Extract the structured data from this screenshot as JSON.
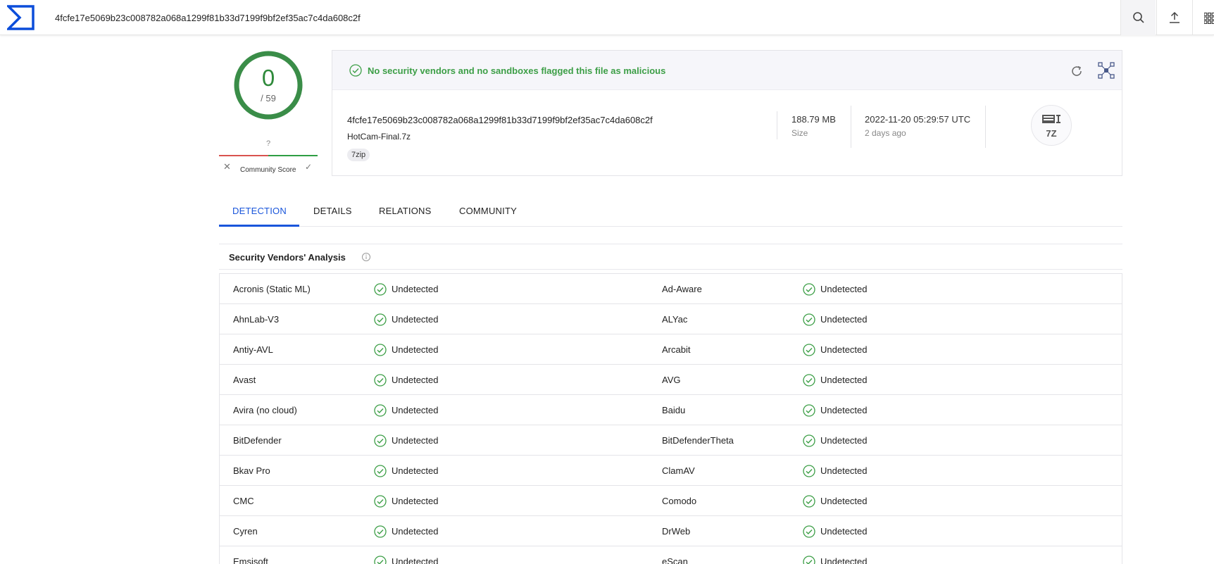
{
  "topbar": {
    "search_value": "4fcfe17e5069b23c008782a068a1299f81b33d7199f9bf2ef35ac7c4da608c2f",
    "icons": [
      "logo-icon",
      "search-icon",
      "upload-icon",
      "apps-grid-icon"
    ]
  },
  "score": {
    "detections": "0",
    "total": "/ 59",
    "ring_color": "#3a8d48"
  },
  "community": {
    "score": "?",
    "label": "Community Score"
  },
  "summary": {
    "message": "No security vendors and no sandboxes flagged this file as malicious",
    "hash": "4fcfe17e5069b23c008782a068a1299f81b33d7199f9bf2ef35ac7c4da608c2f",
    "filename": "HotCam-Final.7z",
    "tag": "7zip",
    "size": "188.79 MB",
    "size_label": "Size",
    "date": "2022-11-20 05:29:57 UTC",
    "date_ago": "2 days ago",
    "file_type": "7Z"
  },
  "tabs": [
    {
      "label": "DETECTION",
      "active": true
    },
    {
      "label": "DETAILS",
      "active": false
    },
    {
      "label": "RELATIONS",
      "active": false
    },
    {
      "label": "COMMUNITY",
      "active": false
    }
  ],
  "section": {
    "title": "Security Vendors' Analysis"
  },
  "vendors": [
    {
      "left": {
        "name": "Acronis (Static ML)",
        "result": "Undetected"
      },
      "right": {
        "name": "Ad-Aware",
        "result": "Undetected"
      }
    },
    {
      "left": {
        "name": "AhnLab-V3",
        "result": "Undetected"
      },
      "right": {
        "name": "ALYac",
        "result": "Undetected"
      }
    },
    {
      "left": {
        "name": "Antiy-AVL",
        "result": "Undetected"
      },
      "right": {
        "name": "Arcabit",
        "result": "Undetected"
      }
    },
    {
      "left": {
        "name": "Avast",
        "result": "Undetected"
      },
      "right": {
        "name": "AVG",
        "result": "Undetected"
      }
    },
    {
      "left": {
        "name": "Avira (no cloud)",
        "result": "Undetected"
      },
      "right": {
        "name": "Baidu",
        "result": "Undetected"
      }
    },
    {
      "left": {
        "name": "BitDefender",
        "result": "Undetected"
      },
      "right": {
        "name": "BitDefenderTheta",
        "result": "Undetected"
      }
    },
    {
      "left": {
        "name": "Bkav Pro",
        "result": "Undetected"
      },
      "right": {
        "name": "ClamAV",
        "result": "Undetected"
      }
    },
    {
      "left": {
        "name": "CMC",
        "result": "Undetected"
      },
      "right": {
        "name": "Comodo",
        "result": "Undetected"
      }
    },
    {
      "left": {
        "name": "Cyren",
        "result": "Undetected"
      },
      "right": {
        "name": "DrWeb",
        "result": "Undetected"
      }
    },
    {
      "left": {
        "name": "Emsisoft",
        "result": "Undetected"
      },
      "right": {
        "name": "eScan",
        "result": "Undetected"
      }
    }
  ],
  "colors": {
    "accent": "#1a56db",
    "ok_green": "#3c9e46"
  }
}
